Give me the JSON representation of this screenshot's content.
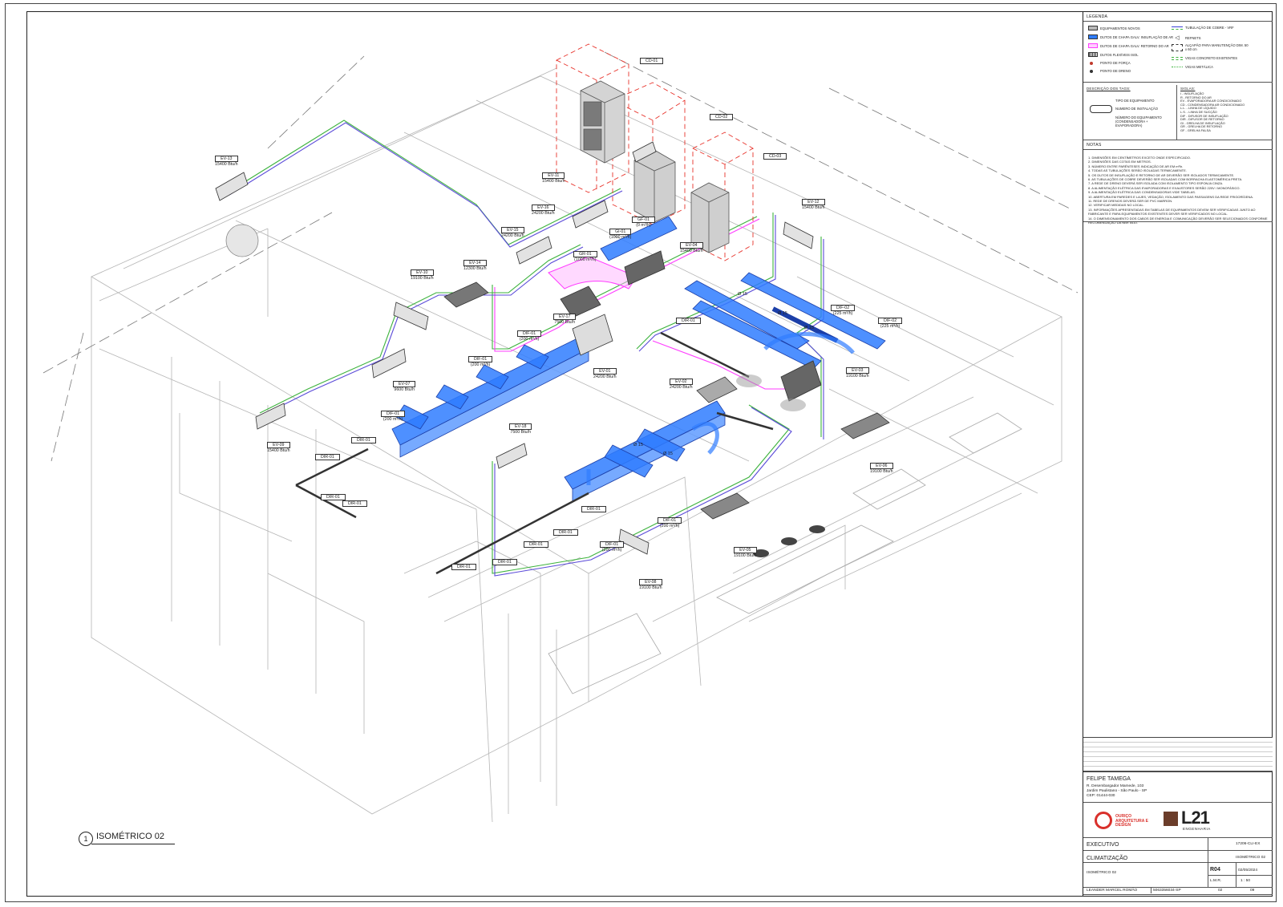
{
  "view_title": "ISOMÉTRICO 02",
  "view_number": "1",
  "legend": {
    "title": "LEGENDA",
    "items_left": [
      {
        "label": "EQUIPAMENTOS NOVOS",
        "color": "#b9b9b9"
      },
      {
        "label": "DUTOS DE CHAPA GALV. INSUFLAÇÃO DE AR",
        "color": "#2f7cff"
      },
      {
        "label": "DUTOS DE CHAPA GALV. RETORNO DO AR",
        "color": "#ff3cff"
      },
      {
        "label": "DUTOS FLEXÍVEIS ISOL",
        "color": "#444444"
      },
      {
        "label": "PONTO DE FORÇA",
        "color": "#c0392b"
      },
      {
        "label": "PONTO DE DRENO",
        "color": "#333333"
      }
    ],
    "items_right": [
      {
        "label": "TUBULAÇÃO DE COBRE - VRF",
        "color": "#3d44d8"
      },
      {
        "label": "REFNETS",
        "color": "#333333"
      },
      {
        "label": "ALÇAPÃO PARA MANUTENÇÃO DIM. 50 x 60 cm",
        "color": "#333333"
      },
      {
        "label": "VIGAS CONCRETO EXISTENTES",
        "color": "#3db33d"
      },
      {
        "label": "VIGAS METÁLICA",
        "color": "#3db33d"
      }
    ]
  },
  "tags_description": {
    "title": "DESCRIÇÃO DOS TAGS:",
    "lines": [
      "TIPO DE EQUIPAMENTO",
      "NUMERO DE INSTALAÇÃO",
      "NÚMERO DO EQUIPAMENTO (CONDENSADORA + EVAPORADORA)"
    ]
  },
  "abbreviations": {
    "title": "SIGLAS:",
    "lines": [
      "I - INSUFLAÇÃO",
      "R - RETORNO DO AR",
      "EV - EVAPORADORA AR CONDICIONADO",
      "CD - CONDENSADORA AR CONDICIONADO",
      "L.L. - LINHA DE LÍQUIDO",
      "L.S. - LINHA DE SUCÇÃO",
      "DIF - DIFUSOR DE INSUFLAÇÃO",
      "DIR - DIFUSOR DE RETORNO",
      "GI - GRELHA DE INSUFLAÇÃO",
      "GR - GRELHA DE RETORNO",
      "GF - GRELHA FALSA"
    ]
  },
  "notes": {
    "title": "NOTAS",
    "lines": [
      "1. DIMENSÕES EM CENTÍMETROS EXCETO ONDE ESPECIFICADO.",
      "2. DIMENSÕES DAS COTAS EM METROS.",
      "3. NÚMERO ENTRE PARÊNTESES INDICAÇÃO DE AR EM m³/h.",
      "4. TODAS AS TUBULAÇÕES SERÃO ISOLADAS TERMICAMENTE.",
      "5. OS DUTOS DE INSUFLAÇÃO E RETORNO DE AR DEVERÃO SER ISOLADOS TERMICAMENTE.",
      "6. AS TUBULAÇÕES DE COBRE DEVERÃO SER ISOLADAS COM BORRACHA ELASTOMÉRICA PRETA.",
      "7. A REDE DE DRENO DEVERÁ SER ISOLADA COM ISOLAMENTO TIPO ESPONJA CINZA.",
      "8. A ALIMENTAÇÃO ELÉTRICA DAS EVAPORADORAS E EXAUSTORES SERÃO 220V / MONOFÁSICO.",
      "9. A ALIMENTAÇÃO ELÉTRICA DAS CONDENSADORAS VIDE TABELAS.",
      "10. ABERTURA EM PAREDES E LAJES, VEDAÇÃO, ISOLAMENTO DAS PASSAGENS DA REDE FRIGORÍGENA.",
      "11. REDE DE DRENOS DEVERÁ SER DE PVC MARRON.",
      "12. VERIFICAR MEDIDAS NO LOCAL.",
      "13. INFORMAÇÕES APRESENTADAS EM TABELAS DE EQUIPAMENTOS DEVEM SER VERIFICADAS JUNTO AO FABRICANTE E PARA EQUIPAMENTOS EXISTENTES DEVER SER VERIFICADOS NO LOCAL.",
      "14. O DIMENSIONAMENTO DOS CABOS DE ENERGIA E COMUNICAÇÃO DEVERÃO SER SELECIONADOS CONFORME RECOMENDAÇÃO DA NBR 5410."
    ]
  },
  "client": {
    "name": "FELIPE TAMEGA",
    "address1": "R. Desembargador Mamede, 103",
    "address2": "Jardim Paulistano - São Paulo - SP",
    "address3": "CEP: 01444-030"
  },
  "logos": {
    "left": "OURIÇO ARQUITETURA E DESIGN",
    "right_big": "L21",
    "right_small": "ENGENHARIA"
  },
  "title_block": {
    "phase": "EXECUTIVO",
    "code": "17206-CLI-EX",
    "discipline": "CLIMATIZAÇÃO",
    "sheet_name": "ISOMÉTRICO 02",
    "subtitle": "ISOMÉTRICO 02",
    "revision": "R04",
    "date": "02/05/2024",
    "drawn_by": "L.M.R.",
    "scale": "1 : 50",
    "engineer": "LEANDER MARCEL ROMÃO",
    "crea": "5063356034-SP",
    "sheet_no": "02",
    "sheet_total": "09"
  },
  "equipment_tags": [
    {
      "id": "CD-01",
      "cap": ""
    },
    {
      "id": "CD-02",
      "cap": ""
    },
    {
      "id": "CD-03",
      "cap": ""
    },
    {
      "id": "EV-13",
      "cap": "15400 Btu/h"
    },
    {
      "id": "EV-11",
      "cap": "15400 Btu/h"
    },
    {
      "id": "EV-12",
      "cap": "15400 Btu/h"
    },
    {
      "id": "EV-16",
      "cap": "24200 Btu/h"
    },
    {
      "id": "EV-15",
      "cap": "24200 Btu/h"
    },
    {
      "id": "EV-14",
      "cap": "12300 Btu/h"
    },
    {
      "id": "EV-10",
      "cap": "19100 Btu/h"
    },
    {
      "id": "EV-04",
      "cap": "15400 Btu/h"
    },
    {
      "id": "EV-17",
      "cap": "7500 Btu/h"
    },
    {
      "id": "EV-07",
      "cap": "9600 Btu/h"
    },
    {
      "id": "EV-01",
      "cap": "24200 Btu/h"
    },
    {
      "id": "EV-02",
      "cap": "24200 Btu/h"
    },
    {
      "id": "EV-03",
      "cap": "19100 Btu/h"
    },
    {
      "id": "EV-09",
      "cap": "15400 Btu/h"
    },
    {
      "id": "EV-18",
      "cap": "7500 Btu/h"
    },
    {
      "id": "EV-06",
      "cap": "19100 Btu/h"
    },
    {
      "id": "EV-05",
      "cap": "19100 Btu/h"
    },
    {
      "id": "EV-08",
      "cap": "19100 Btu/h"
    },
    {
      "id": "GF-01",
      "cap": "(0 m³/h)"
    },
    {
      "id": "GI-01",
      "cap": "(1000 m³/h)"
    },
    {
      "id": "GR-01",
      "cap": "(1000 m³/h)"
    },
    {
      "id": "DIF-01",
      "cap": "(200 m³/h)"
    },
    {
      "id": "DIF-02",
      "cap": "(225 m³/h)"
    },
    {
      "id": "DIR-01",
      "cap": ""
    }
  ],
  "diameter_labels": [
    "Ø 15",
    "Ø 15",
    "Ø 15",
    "Ø 15",
    "Ø 15"
  ]
}
